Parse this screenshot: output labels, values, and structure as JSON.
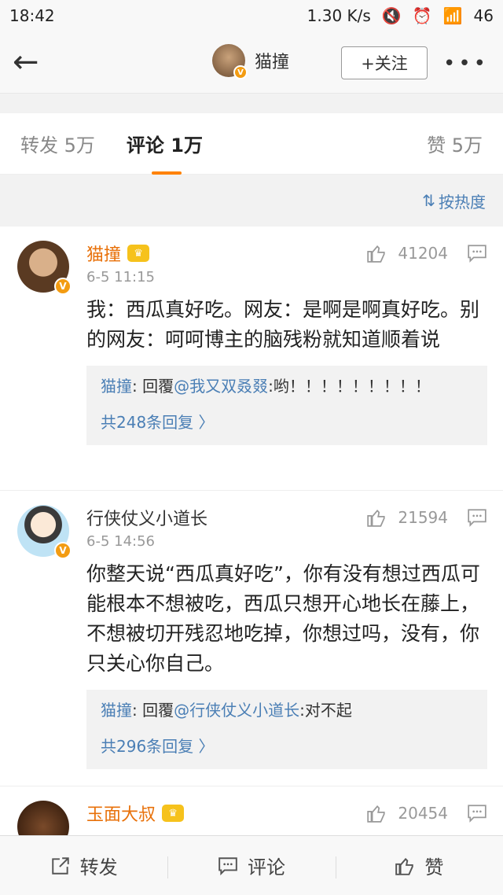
{
  "status": {
    "time": "18:42",
    "speed": "1.30 K/s",
    "battery": "46"
  },
  "nav": {
    "user": "猫撞",
    "follow_label": "+关注",
    "more": "•••"
  },
  "tabs": {
    "repost": "转发 5万",
    "comment": "评论 1万",
    "like": "赞 5万"
  },
  "sort": {
    "label": "按热度"
  },
  "comments": [
    {
      "name": "猫撞",
      "likes": "41204",
      "time": "6-5 11:15",
      "text": "我：西瓜真好吃。网友：是啊是啊真好吃。别的网友：呵呵博主的脑残粉就知道顺着说",
      "reply_user": "猫撞",
      "reply_prefix": ": 回覆",
      "reply_at": "@我又双叒叕",
      "reply_text": ":哟！！！！！！！！！",
      "reply_count": "共248条回复 〉"
    },
    {
      "name": "行侠仗义小道长",
      "likes": "21594",
      "time": "6-5 14:56",
      "text": "你整天说“西瓜真好吃”，你有没有想过西瓜可能根本不想被吃，西瓜只想开心地长在藤上，不想被切开残忍地吃掉，你想过吗，没有，你只关心你自己。",
      "reply_user": "猫撞",
      "reply_prefix": ": 回覆",
      "reply_at": "@行侠仗义小道长",
      "reply_text": ":对不起",
      "reply_count": "共296条回复 〉"
    },
    {
      "name": "玉面大叔",
      "likes": "20454"
    }
  ],
  "bottom": {
    "repost": "转发",
    "comment": "评论",
    "like": "赞"
  },
  "colors": {
    "accent": "#ff8200",
    "link": "#4b7fb5",
    "vip_name": "#e8710a"
  },
  "icons": [
    "back-arrow-icon",
    "thumb-up-icon",
    "comment-icon",
    "share-icon",
    "verified-badge-icon",
    "crown-icon"
  ]
}
